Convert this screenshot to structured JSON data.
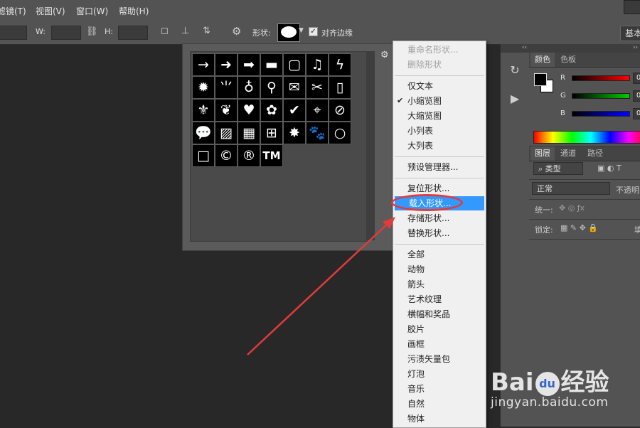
{
  "menubar": {
    "items": [
      "滤镜(T)",
      "视图(V)",
      "窗口(W)",
      "帮助(H)"
    ]
  },
  "options": {
    "w_label": "W:",
    "h_label": "H:",
    "shape_label": "形状:",
    "align_edges_label": "对齐边缘",
    "align_edges_checked": true,
    "workspace_label": "基本"
  },
  "shape_picker": {
    "shapes": [
      {
        "name": "arrow-thin-icon",
        "glyph": "→"
      },
      {
        "name": "arrow-bold-icon",
        "glyph": "➜"
      },
      {
        "name": "arrow-block-icon",
        "glyph": "➡"
      },
      {
        "name": "banner-icon",
        "glyph": "▬"
      },
      {
        "name": "frame-icon",
        "glyph": "▢"
      },
      {
        "name": "music-note-icon",
        "glyph": "♫"
      },
      {
        "name": "lightning-icon",
        "glyph": "ϟ"
      },
      {
        "name": "starburst-icon",
        "glyph": "✹"
      },
      {
        "name": "grass-icon",
        "glyph": "⺌"
      },
      {
        "name": "lightbulb-icon",
        "glyph": "♁"
      },
      {
        "name": "pushpin-icon",
        "glyph": "⚲"
      },
      {
        "name": "envelope-icon",
        "glyph": "✉"
      },
      {
        "name": "scissors-icon",
        "glyph": "✂"
      },
      {
        "name": "stamp-icon",
        "glyph": "▯"
      },
      {
        "name": "fleur-de-lis-icon",
        "glyph": "⚜"
      },
      {
        "name": "ornament-icon",
        "glyph": "❦"
      },
      {
        "name": "heart-icon",
        "glyph": "♥"
      },
      {
        "name": "blob-icon",
        "glyph": "✿"
      },
      {
        "name": "checkmark-icon",
        "glyph": "✔"
      },
      {
        "name": "target-icon",
        "glyph": "⌖"
      },
      {
        "name": "no-sign-icon",
        "glyph": "⊘"
      },
      {
        "name": "speech-bubble-icon",
        "glyph": "💬"
      },
      {
        "name": "diagonal-lines-icon",
        "glyph": "▨"
      },
      {
        "name": "checkerboard-icon",
        "glyph": "▦"
      },
      {
        "name": "grid-icon",
        "glyph": "⊞"
      },
      {
        "name": "burst-icon",
        "glyph": "✸"
      },
      {
        "name": "paw-icon",
        "glyph": "🐾"
      },
      {
        "name": "circle-icon",
        "glyph": "○"
      },
      {
        "name": "square-frame-icon",
        "glyph": "□"
      },
      {
        "name": "copyright-icon",
        "glyph": "©"
      },
      {
        "name": "registered-icon",
        "glyph": "®"
      },
      {
        "name": "trademark-icon",
        "glyph": "TM"
      }
    ]
  },
  "context_menu": {
    "items": [
      {
        "label": "重命名形状...",
        "disabled": true
      },
      {
        "label": "删除形状",
        "disabled": true
      },
      {
        "sep": true
      },
      {
        "label": "仅文本"
      },
      {
        "label": "小缩览图",
        "checked": true
      },
      {
        "label": "大缩览图"
      },
      {
        "label": "小列表"
      },
      {
        "label": "大列表"
      },
      {
        "sep": true
      },
      {
        "label": "预设管理器..."
      },
      {
        "sep": true
      },
      {
        "label": "复位形状..."
      },
      {
        "label": "载入形状...",
        "highlighted": true
      },
      {
        "label": "存储形状..."
      },
      {
        "label": "替换形状..."
      },
      {
        "sep": true
      },
      {
        "label": "全部"
      },
      {
        "label": "动物"
      },
      {
        "label": "箭头"
      },
      {
        "label": "艺术纹理"
      },
      {
        "label": "横幅和奖品"
      },
      {
        "label": "胶片"
      },
      {
        "label": "画框"
      },
      {
        "label": "污渍矢量包"
      },
      {
        "label": "灯泡"
      },
      {
        "label": "音乐"
      },
      {
        "label": "自然"
      },
      {
        "label": "物体"
      }
    ]
  },
  "color_panel": {
    "tabs": [
      "颜色",
      "色板"
    ],
    "r_label": "R",
    "g_label": "G",
    "b_label": "B",
    "r_value": "0",
    "g_value": "0",
    "b_value": "0"
  },
  "layers_panel": {
    "tabs": [
      "图层",
      "通道",
      "路径"
    ],
    "filter_label": "类型",
    "blend_mode": "正常",
    "opacity_label": "不透明",
    "unify_label": "统一:",
    "lock_label": "锁定:",
    "fill_label": "填"
  },
  "watermark": {
    "logo": "Bai",
    "logo_paw": "du",
    "logo_suffix": "经验",
    "url": "jingyan.baidu.com"
  },
  "colors": {
    "highlight": "#3399ff",
    "annotation": "#e33a3a"
  }
}
